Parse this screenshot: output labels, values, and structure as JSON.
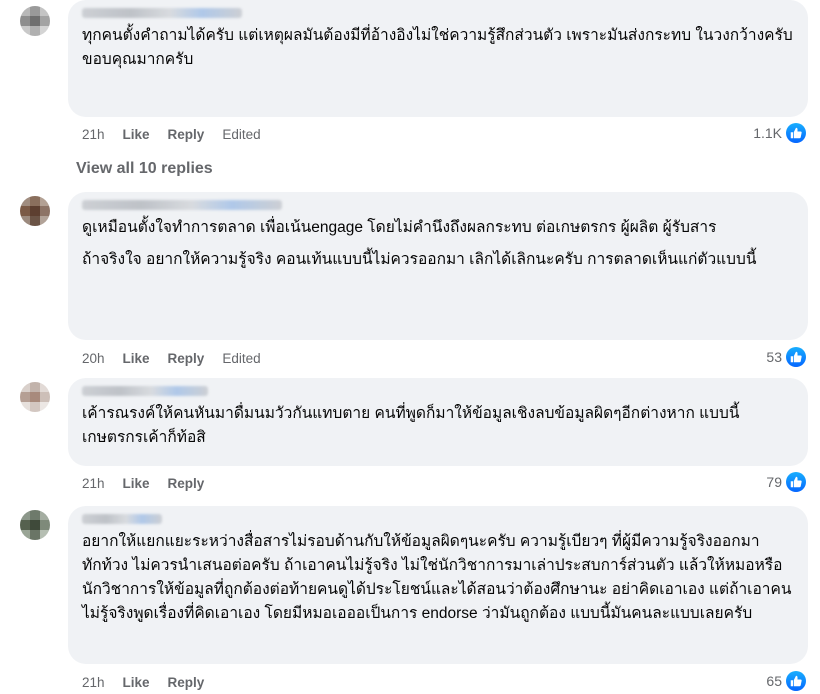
{
  "comments": [
    {
      "paragraphs": [
        "ทุกคนตั้งคำถามได้ครับ แต่เหตุผลมันต้องมีที่อ้างอิงไม่ใช่ความรู้สึกส่วนตัว เพราะมันส่งกระทบ ในวงกว้างครับ\nขอบคุณมากครับ"
      ],
      "time": "21h",
      "like": "Like",
      "reply": "Reply",
      "edited": "Edited",
      "reaction_count": "1.1K"
    },
    {
      "paragraphs": [
        "ดูเหมือนตั้งใจทำการตลาด เพื่อเน้นengage โดยไม่คำนึงถึงผลกระทบ ต่อเกษตรกร ผู้ผลิต ผู้รับสาร",
        "ถ้าจริงใจ อยากให้ความรู้จริง คอนเท้นแบบนี้ไม่ควรออกมา เลิกได้เลิกนะครับ การตลาดเห็นแก่ตัวแบบนี้"
      ],
      "time": "20h",
      "like": "Like",
      "reply": "Reply",
      "edited": "Edited",
      "reaction_count": "53"
    },
    {
      "paragraphs": [
        "เค้ารณรงค์ให้คนหันมาดื่มนมวัวกันแทบตาย คนที่พูดก็มาให้ข้อมูลเชิงลบข้อมูลผิดๆอีกต่างหาก แบบนี้เกษตรกรเค้าก็ท้อสิ"
      ],
      "time": "21h",
      "like": "Like",
      "reply": "Reply",
      "reaction_count": "79"
    },
    {
      "paragraphs": [
        "อยากให้แยกแยะระหว่างสื่อสารไม่รอบด้านกับให้ข้อมูลผิดๆนะครับ ความรู้เบียวๆ ที่ผู้มีความรู้จริงออกมาทักท้วง ไม่ควรนำเสนอต่อครับ ถ้าเอาคนไม่รู้จริง ไม่ใช่นักวิชาการมาเล่าประสบการ์ส่วนตัว แล้วให้หมอหรือนักวิชาการให้ข้อมูลที่ถูกต้องต่อท้ายคนดูได้ประโยชน์และได้สอนว่าต้องศึกษานะ อย่าคิดเอาเอง แต่ถ้าเอาคนไม่รู้จริงพูดเรื่องที่คิดเอาเอง โดยมีหมอเอออเป็นการ endorse ว่ามันถูกต้อง แบบนี้มันคนละแบบเลยครับ"
      ],
      "time": "21h",
      "like": "Like",
      "reply": "Reply",
      "reaction_count": "65"
    }
  ],
  "view_replies": "View all 10 replies",
  "colors": {
    "bubble": "#f0f2f5",
    "meta": "#65676b",
    "like_badge": "#0866ff"
  },
  "icons": {
    "reaction": "thumbs-up-icon",
    "avatar": "blurred-avatar"
  }
}
